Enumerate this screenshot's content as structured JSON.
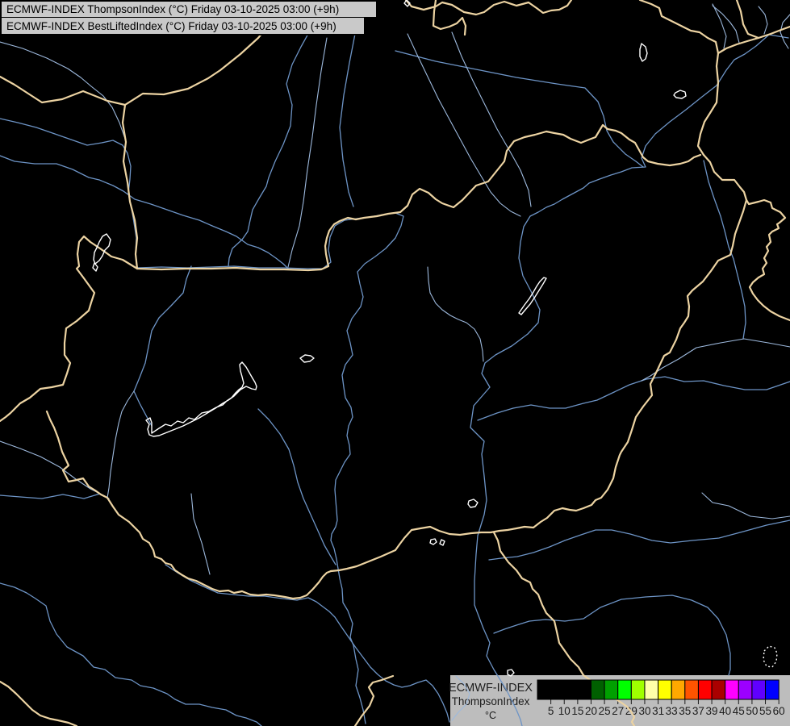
{
  "header": {
    "line1": "ECMWF-INDEX ThompsonIndex (°C) Friday 03-10-2025 03:00 (+9h)",
    "line2": "ECMWF-INDEX BestLiftedIndex (°C) Friday 03-10-2025 03:00 (+9h)"
  },
  "legend": {
    "source_label": "ECMWF-INDEX",
    "index_label": "ThompsonIndex",
    "unit_label": "°C",
    "tick_labels": [
      "5",
      "10",
      "15",
      "20",
      "25",
      "27",
      "29",
      "30",
      "31",
      "33",
      "35",
      "37",
      "39",
      "40",
      "45",
      "50",
      "55",
      "60"
    ],
    "segment_colors": [
      "#000000",
      "#000000",
      "#000000",
      "#000000",
      "#006000",
      "#00a000",
      "#00ff00",
      "#9fff00",
      "#ffffa8",
      "#ffff00",
      "#ffa800",
      "#ff5400",
      "#ff0000",
      "#aa0000",
      "#ff00ff",
      "#9c00ff",
      "#6000ff",
      "#0000ff"
    ]
  },
  "colors": {
    "background": "#000000",
    "country_border": "#ecd3a2",
    "river_main": "#6d94c6",
    "river_minor": "#9db9dd",
    "lake_outline": "#ffffff",
    "titlebar_bg": "#c9c9c9",
    "legend_bg": "#bdbdbd",
    "text": "#000000"
  }
}
